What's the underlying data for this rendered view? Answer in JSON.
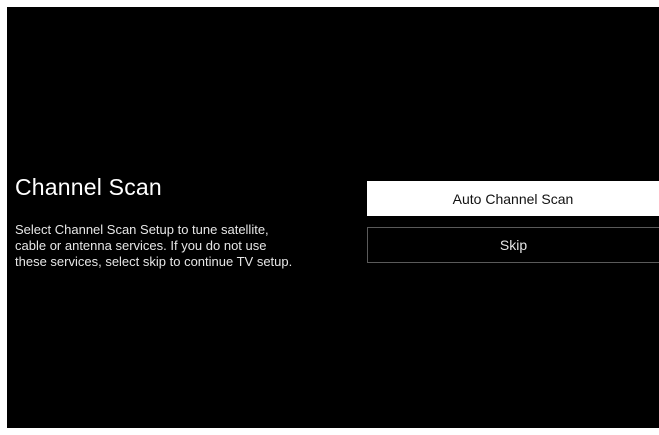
{
  "screen": {
    "title": "Channel Scan",
    "description_lines": [
      "Select Channel Scan Setup to tune satellite,",
      "cable or antenna services. If you do not use",
      "these services, select skip to continue TV setup."
    ]
  },
  "menu": {
    "options": [
      {
        "label": "Auto Channel Scan",
        "focused": true
      },
      {
        "label": "Skip",
        "focused": false
      }
    ]
  },
  "colors": {
    "background": "#000000",
    "text": "#ffffff",
    "focused_button_bg": "#ffffff",
    "focused_button_text": "#111111",
    "button_border": "#5a5a5a"
  }
}
